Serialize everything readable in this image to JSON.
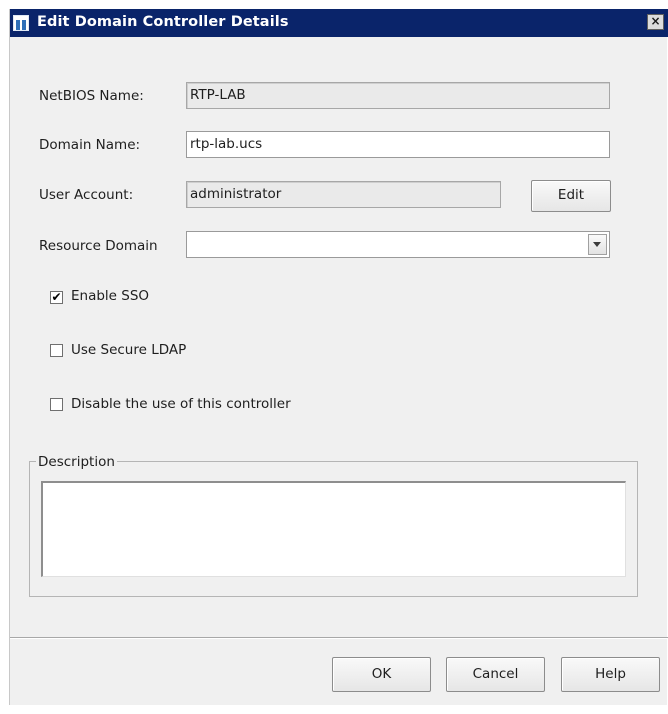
{
  "window": {
    "title": "Edit Domain Controller Details",
    "close_glyph": "×"
  },
  "form": {
    "netbios_label": "NetBIOS Name:",
    "netbios_value": "RTP-LAB",
    "domain_label": "Domain Name:",
    "domain_value": "rtp-lab.ucs",
    "user_label": "User Account:",
    "user_value": "administrator",
    "edit_label": "Edit",
    "resource_label": "Resource Domain",
    "resource_value": ""
  },
  "options": {
    "enable_sso_label": "Enable SSO",
    "enable_sso_checked": true,
    "secure_ldap_label": "Use Secure LDAP",
    "secure_ldap_checked": false,
    "disable_label": "Disable the use of this controller",
    "disable_checked": false,
    "check_glyph": "✔"
  },
  "description": {
    "legend": "Description",
    "value": ""
  },
  "footer": {
    "ok_label": "OK",
    "cancel_label": "Cancel",
    "help_label": "Help"
  },
  "colors": {
    "title_bar": "#0a246a",
    "dialog_bg": "#f0f0f0"
  },
  "icons": {
    "app": "app-logo-icon",
    "close": "close-icon",
    "dropdown": "chevron-down-icon",
    "check": "checkmark-icon"
  }
}
